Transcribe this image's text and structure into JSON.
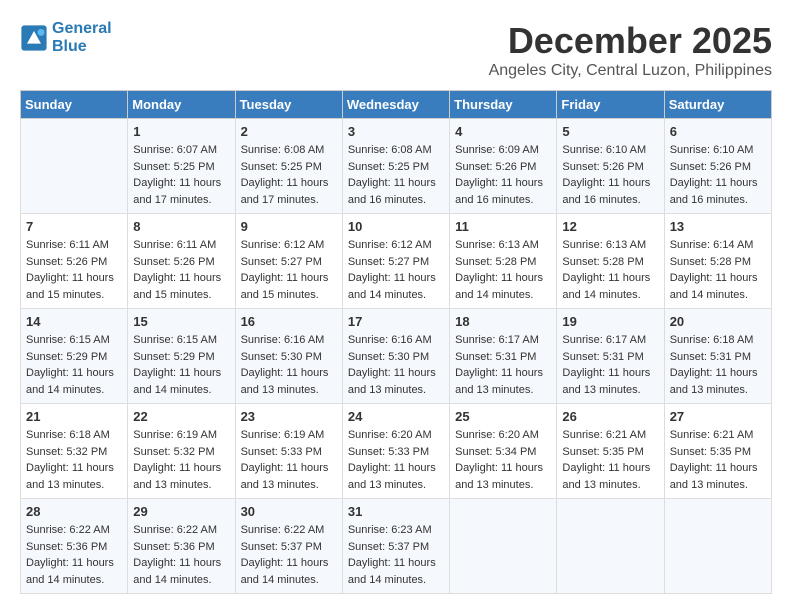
{
  "logo": {
    "line1": "General",
    "line2": "Blue"
  },
  "title": "December 2025",
  "location": "Angeles City, Central Luzon, Philippines",
  "weekdays": [
    "Sunday",
    "Monday",
    "Tuesday",
    "Wednesday",
    "Thursday",
    "Friday",
    "Saturday"
  ],
  "weeks": [
    [
      {
        "day": "",
        "info": ""
      },
      {
        "day": "1",
        "info": "Sunrise: 6:07 AM\nSunset: 5:25 PM\nDaylight: 11 hours\nand 17 minutes."
      },
      {
        "day": "2",
        "info": "Sunrise: 6:08 AM\nSunset: 5:25 PM\nDaylight: 11 hours\nand 17 minutes."
      },
      {
        "day": "3",
        "info": "Sunrise: 6:08 AM\nSunset: 5:25 PM\nDaylight: 11 hours\nand 16 minutes."
      },
      {
        "day": "4",
        "info": "Sunrise: 6:09 AM\nSunset: 5:26 PM\nDaylight: 11 hours\nand 16 minutes."
      },
      {
        "day": "5",
        "info": "Sunrise: 6:10 AM\nSunset: 5:26 PM\nDaylight: 11 hours\nand 16 minutes."
      },
      {
        "day": "6",
        "info": "Sunrise: 6:10 AM\nSunset: 5:26 PM\nDaylight: 11 hours\nand 16 minutes."
      }
    ],
    [
      {
        "day": "7",
        "info": "Sunrise: 6:11 AM\nSunset: 5:26 PM\nDaylight: 11 hours\nand 15 minutes."
      },
      {
        "day": "8",
        "info": "Sunrise: 6:11 AM\nSunset: 5:26 PM\nDaylight: 11 hours\nand 15 minutes."
      },
      {
        "day": "9",
        "info": "Sunrise: 6:12 AM\nSunset: 5:27 PM\nDaylight: 11 hours\nand 15 minutes."
      },
      {
        "day": "10",
        "info": "Sunrise: 6:12 AM\nSunset: 5:27 PM\nDaylight: 11 hours\nand 14 minutes."
      },
      {
        "day": "11",
        "info": "Sunrise: 6:13 AM\nSunset: 5:28 PM\nDaylight: 11 hours\nand 14 minutes."
      },
      {
        "day": "12",
        "info": "Sunrise: 6:13 AM\nSunset: 5:28 PM\nDaylight: 11 hours\nand 14 minutes."
      },
      {
        "day": "13",
        "info": "Sunrise: 6:14 AM\nSunset: 5:28 PM\nDaylight: 11 hours\nand 14 minutes."
      }
    ],
    [
      {
        "day": "14",
        "info": "Sunrise: 6:15 AM\nSunset: 5:29 PM\nDaylight: 11 hours\nand 14 minutes."
      },
      {
        "day": "15",
        "info": "Sunrise: 6:15 AM\nSunset: 5:29 PM\nDaylight: 11 hours\nand 14 minutes."
      },
      {
        "day": "16",
        "info": "Sunrise: 6:16 AM\nSunset: 5:30 PM\nDaylight: 11 hours\nand 13 minutes."
      },
      {
        "day": "17",
        "info": "Sunrise: 6:16 AM\nSunset: 5:30 PM\nDaylight: 11 hours\nand 13 minutes."
      },
      {
        "day": "18",
        "info": "Sunrise: 6:17 AM\nSunset: 5:31 PM\nDaylight: 11 hours\nand 13 minutes."
      },
      {
        "day": "19",
        "info": "Sunrise: 6:17 AM\nSunset: 5:31 PM\nDaylight: 11 hours\nand 13 minutes."
      },
      {
        "day": "20",
        "info": "Sunrise: 6:18 AM\nSunset: 5:31 PM\nDaylight: 11 hours\nand 13 minutes."
      }
    ],
    [
      {
        "day": "21",
        "info": "Sunrise: 6:18 AM\nSunset: 5:32 PM\nDaylight: 11 hours\nand 13 minutes."
      },
      {
        "day": "22",
        "info": "Sunrise: 6:19 AM\nSunset: 5:32 PM\nDaylight: 11 hours\nand 13 minutes."
      },
      {
        "day": "23",
        "info": "Sunrise: 6:19 AM\nSunset: 5:33 PM\nDaylight: 11 hours\nand 13 minutes."
      },
      {
        "day": "24",
        "info": "Sunrise: 6:20 AM\nSunset: 5:33 PM\nDaylight: 11 hours\nand 13 minutes."
      },
      {
        "day": "25",
        "info": "Sunrise: 6:20 AM\nSunset: 5:34 PM\nDaylight: 11 hours\nand 13 minutes."
      },
      {
        "day": "26",
        "info": "Sunrise: 6:21 AM\nSunset: 5:35 PM\nDaylight: 11 hours\nand 13 minutes."
      },
      {
        "day": "27",
        "info": "Sunrise: 6:21 AM\nSunset: 5:35 PM\nDaylight: 11 hours\nand 13 minutes."
      }
    ],
    [
      {
        "day": "28",
        "info": "Sunrise: 6:22 AM\nSunset: 5:36 PM\nDaylight: 11 hours\nand 14 minutes."
      },
      {
        "day": "29",
        "info": "Sunrise: 6:22 AM\nSunset: 5:36 PM\nDaylight: 11 hours\nand 14 minutes."
      },
      {
        "day": "30",
        "info": "Sunrise: 6:22 AM\nSunset: 5:37 PM\nDaylight: 11 hours\nand 14 minutes."
      },
      {
        "day": "31",
        "info": "Sunrise: 6:23 AM\nSunset: 5:37 PM\nDaylight: 11 hours\nand 14 minutes."
      },
      {
        "day": "",
        "info": ""
      },
      {
        "day": "",
        "info": ""
      },
      {
        "day": "",
        "info": ""
      }
    ]
  ]
}
